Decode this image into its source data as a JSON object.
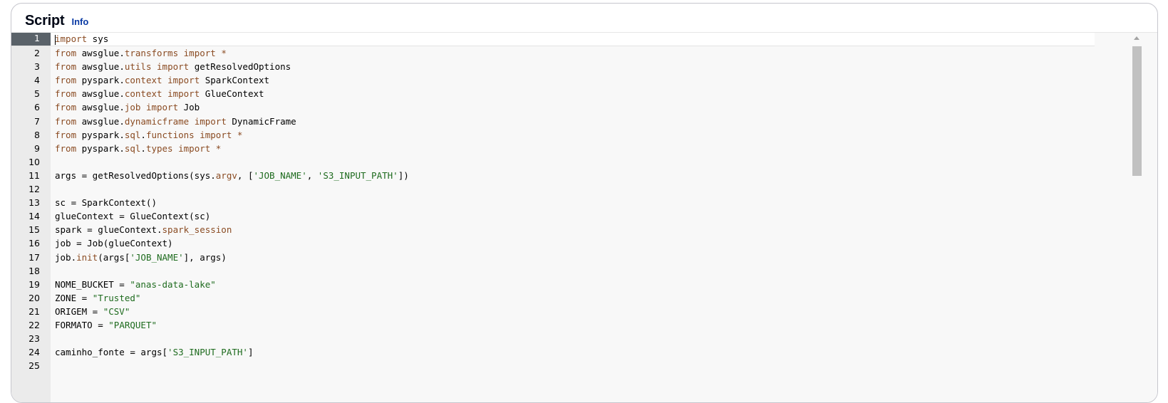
{
  "panel": {
    "title": "Script",
    "info_label": "Info"
  },
  "editor": {
    "active_line": 1,
    "lines": [
      {
        "n": "1",
        "t": [
          [
            "kw",
            "import"
          ],
          [
            "",
            " sys"
          ]
        ]
      },
      {
        "n": "2",
        "t": [
          [
            "kw",
            "from"
          ],
          [
            "",
            " awsglue."
          ],
          [
            "attr",
            "transforms"
          ],
          [
            "",
            " "
          ],
          [
            "kw",
            "import"
          ],
          [
            "op",
            " *"
          ]
        ]
      },
      {
        "n": "3",
        "t": [
          [
            "kw",
            "from"
          ],
          [
            "",
            " awsglue."
          ],
          [
            "attr",
            "utils"
          ],
          [
            "",
            " "
          ],
          [
            "kw",
            "import"
          ],
          [
            "",
            " getResolvedOptions"
          ]
        ]
      },
      {
        "n": "4",
        "t": [
          [
            "kw",
            "from"
          ],
          [
            "",
            " pyspark."
          ],
          [
            "attr",
            "context"
          ],
          [
            "",
            " "
          ],
          [
            "kw",
            "import"
          ],
          [
            "",
            " SparkContext"
          ]
        ]
      },
      {
        "n": "5",
        "t": [
          [
            "kw",
            "from"
          ],
          [
            "",
            " awsglue."
          ],
          [
            "attr",
            "context"
          ],
          [
            "",
            " "
          ],
          [
            "kw",
            "import"
          ],
          [
            "",
            " GlueContext"
          ]
        ]
      },
      {
        "n": "6",
        "t": [
          [
            "kw",
            "from"
          ],
          [
            "",
            " awsglue."
          ],
          [
            "attr",
            "job"
          ],
          [
            "",
            " "
          ],
          [
            "kw",
            "import"
          ],
          [
            "",
            " Job"
          ]
        ]
      },
      {
        "n": "7",
        "t": [
          [
            "kw",
            "from"
          ],
          [
            "",
            " awsglue."
          ],
          [
            "attr",
            "dynamicframe"
          ],
          [
            "",
            " "
          ],
          [
            "kw",
            "import"
          ],
          [
            "",
            " DynamicFrame"
          ]
        ]
      },
      {
        "n": "8",
        "t": [
          [
            "kw",
            "from"
          ],
          [
            "",
            " pyspark."
          ],
          [
            "attr",
            "sql"
          ],
          [
            "",
            "."
          ],
          [
            "attr",
            "functions"
          ],
          [
            "",
            " "
          ],
          [
            "kw",
            "import"
          ],
          [
            "op",
            " *"
          ]
        ]
      },
      {
        "n": "9",
        "t": [
          [
            "kw",
            "from"
          ],
          [
            "",
            " pyspark."
          ],
          [
            "attr",
            "sql"
          ],
          [
            "",
            "."
          ],
          [
            "attr",
            "types"
          ],
          [
            "",
            " "
          ],
          [
            "kw",
            "import"
          ],
          [
            "op",
            " *"
          ]
        ]
      },
      {
        "n": "10",
        "t": []
      },
      {
        "n": "11",
        "t": [
          [
            "",
            "args = getResolvedOptions(sys."
          ],
          [
            "attr",
            "argv"
          ],
          [
            "",
            ", ["
          ],
          [
            "str",
            "'JOB_NAME'"
          ],
          [
            "",
            ", "
          ],
          [
            "str",
            "'S3_INPUT_PATH'"
          ],
          [
            "",
            "])"
          ]
        ]
      },
      {
        "n": "12",
        "t": []
      },
      {
        "n": "13",
        "t": [
          [
            "",
            "sc = SparkContext()"
          ]
        ]
      },
      {
        "n": "14",
        "t": [
          [
            "",
            "glueContext = GlueContext(sc)"
          ]
        ]
      },
      {
        "n": "15",
        "t": [
          [
            "",
            "spark = glueContext."
          ],
          [
            "attr",
            "spark_session"
          ]
        ]
      },
      {
        "n": "16",
        "t": [
          [
            "",
            "job = Job(glueContext)"
          ]
        ]
      },
      {
        "n": "17",
        "t": [
          [
            "",
            "job."
          ],
          [
            "attr",
            "init"
          ],
          [
            "",
            "(args["
          ],
          [
            "str",
            "'JOB_NAME'"
          ],
          [
            "",
            "], args)"
          ]
        ]
      },
      {
        "n": "18",
        "t": []
      },
      {
        "n": "19",
        "t": [
          [
            "",
            "NOME_BUCKET = "
          ],
          [
            "str",
            "\"anas-data-lake\""
          ]
        ]
      },
      {
        "n": "20",
        "t": [
          [
            "",
            "ZONE = "
          ],
          [
            "str",
            "\"Trusted\""
          ]
        ]
      },
      {
        "n": "21",
        "t": [
          [
            "",
            "ORIGEM = "
          ],
          [
            "str",
            "\"CSV\""
          ]
        ]
      },
      {
        "n": "22",
        "t": [
          [
            "",
            "FORMATO = "
          ],
          [
            "str",
            "\"PARQUET\""
          ]
        ]
      },
      {
        "n": "23",
        "t": []
      },
      {
        "n": "24",
        "t": [
          [
            "",
            "caminho_fonte = args["
          ],
          [
            "str",
            "'S3_INPUT_PATH'"
          ],
          [
            "",
            "]"
          ]
        ]
      },
      {
        "n": "25",
        "t": []
      }
    ]
  }
}
